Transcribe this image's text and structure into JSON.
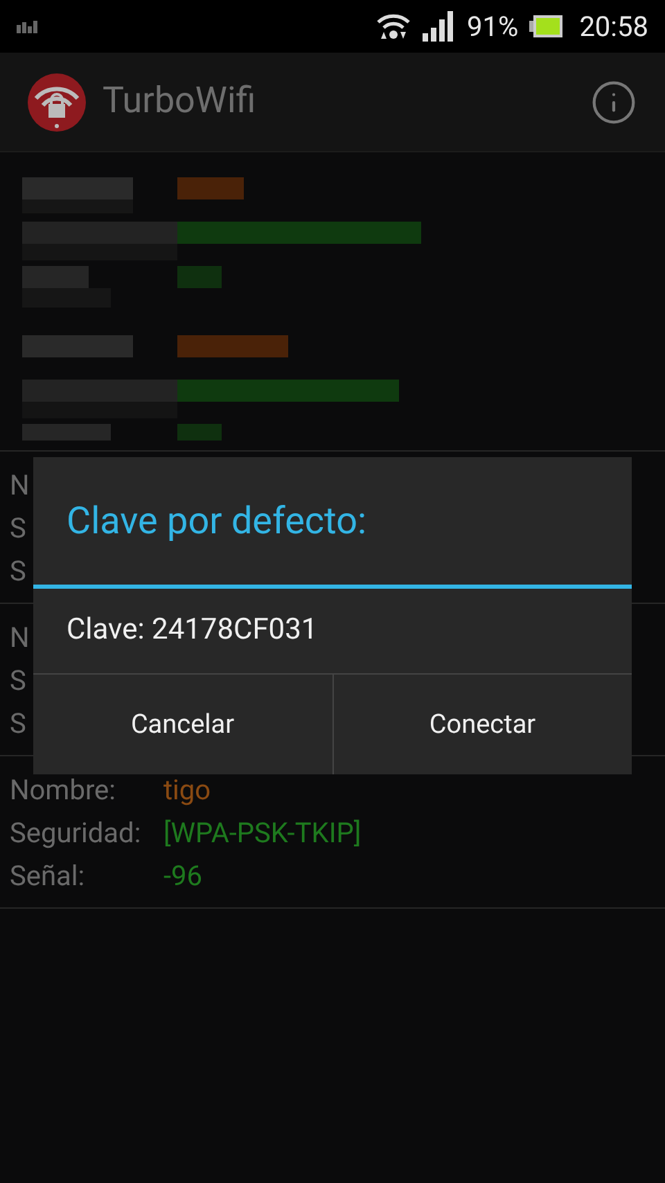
{
  "status_bar": {
    "battery": "91%",
    "time": "20:58"
  },
  "app_bar": {
    "title": "TurboWifi"
  },
  "networks": [
    {
      "fields": [
        {
          "label": "N"
        },
        {
          "label": "S"
        },
        {
          "label": "S"
        }
      ]
    },
    {
      "fields": [
        {
          "label": "N"
        },
        {
          "label": "S"
        },
        {
          "label": "S"
        }
      ]
    },
    {
      "fields": [
        {
          "label": "Nombre:",
          "value": "tigo",
          "kind": "name"
        },
        {
          "label": "Seguridad:",
          "value": "[WPA-PSK-TKIP]",
          "kind": "security"
        },
        {
          "label": "Señal:",
          "value": "-96",
          "kind": "signal"
        }
      ]
    }
  ],
  "dialog": {
    "title": "Clave por defecto:",
    "message": "Clave: 24178CF031",
    "buttons": [
      "Cancelar",
      "Conectar"
    ]
  }
}
